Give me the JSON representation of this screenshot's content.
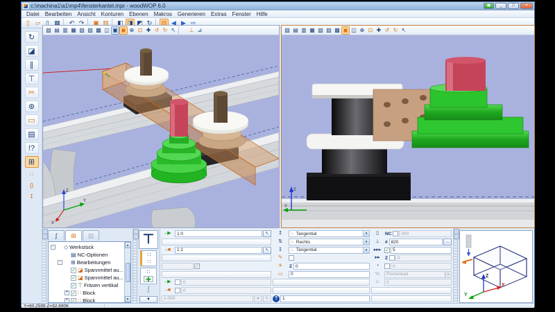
{
  "window": {
    "title": "c:\\machina1\\a1\\mp4\\fensterkantel.mpr - woodWOP 6.0",
    "buttons": {
      "lang": "▣",
      "minimize": "_",
      "maximize": "□",
      "close": "×"
    }
  },
  "menu_bar": {
    "items": [
      {
        "name": "menu-datei",
        "label": "Datei"
      },
      {
        "name": "menu-bearbeiten",
        "label": "Bearbeiten"
      },
      {
        "name": "menu-ansicht",
        "label": "Ansicht"
      },
      {
        "name": "menu-konturen",
        "label": "Konturen"
      },
      {
        "name": "menu-ebenen",
        "label": "Ebenen"
      },
      {
        "name": "menu-makros",
        "label": "Makros"
      },
      {
        "name": "menu-generieren",
        "label": "Generieren"
      },
      {
        "name": "menu-extras",
        "label": "Extras"
      },
      {
        "name": "menu-fenster",
        "label": "Fenster"
      },
      {
        "name": "menu-hilfe",
        "label": "Hilfe"
      }
    ]
  },
  "main_toolbar": {
    "items": [
      {
        "name": "new-file-button",
        "glyph": "▯",
        "cls": "c-orange"
      },
      {
        "name": "open-file-button",
        "glyph": "▱",
        "cls": "c-orange"
      },
      {
        "name": "new-from-template-button",
        "glyph": "▯"
      },
      {
        "name": "save-button",
        "glyph": "▦"
      },
      {
        "name": "separator",
        "glyph": "",
        "cls": "sep"
      },
      {
        "name": "undo-button",
        "glyph": "↶"
      },
      {
        "name": "redo-button",
        "glyph": "↷"
      },
      {
        "name": "separator",
        "glyph": "",
        "cls": "sep"
      },
      {
        "name": "copy-sheet-button",
        "glyph": "▣",
        "cls": "c-orange"
      },
      {
        "name": "paste-sheet-button",
        "glyph": "▥",
        "cls": "c-orange"
      },
      {
        "name": "separator",
        "glyph": "",
        "cls": "sep"
      },
      {
        "name": "view-wireframe-button",
        "glyph": "◧"
      },
      {
        "name": "view-shaded-button",
        "glyph": "◨",
        "cls": "sel"
      },
      {
        "name": "view-solid-button",
        "glyph": "◩"
      },
      {
        "name": "rotate-view-button",
        "glyph": "↻"
      },
      {
        "name": "separator",
        "glyph": "",
        "cls": "sep"
      },
      {
        "name": "nc-generate-button",
        "glyph": "▨",
        "cls": "sel c-orange"
      },
      {
        "name": "nav-back-button",
        "glyph": "◀",
        "cls": "c-blue"
      },
      {
        "name": "nav-play-button",
        "glyph": "▶",
        "cls": "c-blue"
      },
      {
        "name": "nav-forward-button",
        "glyph": "⇨",
        "cls": "c-blue"
      }
    ]
  },
  "left_toolbar": {
    "items": [
      {
        "name": "contour-rotate-button",
        "glyph": "↻"
      },
      {
        "name": "workplane-button",
        "glyph": "◪"
      },
      {
        "name": "drill-horizontal-button",
        "glyph": "∥"
      },
      {
        "name": "mill-vertical-button",
        "glyph": "⊤"
      },
      {
        "name": "saw-button",
        "glyph": "✂",
        "cls": "c-orange"
      },
      {
        "name": "circular-saw-button",
        "glyph": "⊛"
      },
      {
        "name": "pocket-button",
        "glyph": "▭",
        "cls": "c-orange"
      },
      {
        "name": "nc-document-button",
        "glyph": "▤"
      },
      {
        "name": "help-edit-button",
        "glyph": "!?"
      },
      {
        "name": "components-button",
        "glyph": "⊞",
        "cls": "sel"
      },
      {
        "name": "variables-button",
        "glyph": "∷",
        "cls": "small"
      },
      {
        "name": "braces-button",
        "glyph": "{}",
        "cls": "small"
      },
      {
        "name": "teach-button",
        "glyph": "↧",
        "cls": "small"
      }
    ]
  },
  "viewports": {
    "left": {
      "toolbar_items": [
        {
          "name": "view-iso-button",
          "glyph": "▧"
        },
        {
          "name": "view-front-button",
          "glyph": "▤"
        },
        {
          "name": "view-side-button",
          "glyph": "▥"
        },
        {
          "name": "view-top-button",
          "glyph": "▦"
        },
        {
          "name": "view-iso2-button",
          "glyph": "▧"
        },
        {
          "name": "view-iso3-button",
          "glyph": "▨"
        },
        {
          "name": "view-iso4-button",
          "glyph": "▩"
        },
        {
          "name": "view-custom-button",
          "glyph": "◫"
        },
        {
          "name": "shaded-view-button",
          "glyph": "▣",
          "cls": "sel-blue"
        },
        {
          "name": "textured-view-button",
          "glyph": "▣",
          "cls": "sel c-orange"
        },
        {
          "name": "zoom-in-button",
          "glyph": "⊕"
        },
        {
          "name": "zoom-window-button",
          "glyph": "⊡",
          "cls": "c-orange"
        },
        {
          "name": "pan-button",
          "glyph": "✚"
        },
        {
          "name": "rotate-free-button",
          "glyph": "↺",
          "cls": "c-orange"
        },
        {
          "name": "rotate-axis-button",
          "glyph": "↻",
          "cls": "c-orange"
        },
        {
          "name": "pointer-button",
          "glyph": "↖"
        },
        {
          "name": "separator",
          "glyph": "",
          "cls": "sep"
        },
        {
          "name": "measure-button",
          "glyph": "⊥",
          "cls": "c-orange"
        },
        {
          "name": "measure-angle-button",
          "glyph": "⊿"
        }
      ],
      "axis": {
        "x": "X",
        "y": "Y",
        "z": "Z"
      }
    },
    "right": {
      "toolbar_items": [
        {
          "name": "view-iso-button",
          "glyph": "▧"
        },
        {
          "name": "view-front-button",
          "glyph": "▤"
        },
        {
          "name": "view-side-button",
          "glyph": "▥"
        },
        {
          "name": "view-top-button",
          "glyph": "▦"
        },
        {
          "name": "view-iso2-button",
          "glyph": "▧"
        },
        {
          "name": "view-iso3-button",
          "glyph": "▨"
        },
        {
          "name": "view-iso4-button",
          "glyph": "▩"
        },
        {
          "name": "textured-view-button",
          "glyph": "▣",
          "cls": "sel c-orange"
        },
        {
          "name": "view-custom-button",
          "glyph": "◫"
        },
        {
          "name": "zoom-in-button",
          "glyph": "⊕"
        },
        {
          "name": "zoom-window-button",
          "glyph": "⊡",
          "cls": "c-orange"
        },
        {
          "name": "pan-button",
          "glyph": "✚"
        },
        {
          "name": "rotate-free-button",
          "glyph": "↺",
          "cls": "c-orange"
        },
        {
          "name": "rotate-axis-button",
          "glyph": "↻",
          "cls": "c-orange"
        },
        {
          "name": "pointer-button",
          "glyph": "↖"
        }
      ],
      "axis": {
        "y": "Y",
        "z": "Z"
      }
    }
  },
  "tree_panel": {
    "tabs": [
      {
        "name": "tab-contours",
        "glyph": "ʃ"
      },
      {
        "name": "tab-components",
        "glyph": "⊞",
        "cls": "active"
      },
      {
        "name": "tab-list",
        "glyph": "▤",
        "cls": "disabled"
      }
    ],
    "items": [
      {
        "name": "werkstueck",
        "expand": "-",
        "icon": "◇",
        "label": "Werkstück",
        "cls": "ind0 ic-navy"
      },
      {
        "name": "nc-optionen",
        "icon": "▤",
        "label": "NC-Optionen",
        "cls": "ind1 ic-navy"
      },
      {
        "name": "bearbeitungen",
        "expand": "-",
        "icon": "⊞",
        "label": "Bearbeitungen",
        "cls": "ind1 ic-navy"
      },
      {
        "name": "spannmittel-1",
        "check": "✓",
        "icon": "◪",
        "label": "Spannmittel au...",
        "cls": "ind2 ic-orange"
      },
      {
        "name": "spannmittel-2",
        "check": "✓",
        "icon": "◪",
        "label": "Spannmittel au...",
        "cls": "ind2 ic-orange"
      },
      {
        "name": "fraesen-vertikal",
        "check": "✓",
        "icon": "⊤",
        "label": "Fräsen vertikal",
        "cls": "ind2 ic-green"
      },
      {
        "name": "block-1",
        "expand": "+",
        "check": "✓",
        "icon": "∷",
        "label": "Block",
        "cls": "ind2 ic-orange"
      },
      {
        "name": "block-2",
        "expand": "+",
        "check": "✓",
        "icon": "∷",
        "label": "Block",
        "cls": "ind2 ic-orange"
      }
    ]
  },
  "icons": {
    "start": "–▶",
    "end": "–■",
    "picker": "↖",
    "approach": "↥",
    "correction": "⇅",
    "depart": "↧",
    "ramp": "✎",
    "gear": "✳",
    "pocket": "▭",
    "nc_doc": "▯",
    "toolchange": "⊥",
    "feed": "▸▸▸",
    "feed_z": "▸▸",
    "dwell": "◔",
    "spare": "⊔",
    "dd": "▾",
    "more": "…",
    "check": "✓",
    "plus": "✚",
    "scurve": "ʃ",
    "router": "⊤",
    "group": "∷",
    "up": "▲",
    "down": "▼"
  },
  "macro_panel": {
    "start_value": "1:0",
    "end_value": "1:1",
    "approach_value": "Tangential",
    "correction_value": "Rechts",
    "depart_value": "Tangential",
    "z_label": "Z",
    "z_value": "0",
    "pocket_value": "0",
    "aux_in_value": "0",
    "aux_out_value": "0",
    "length_value": "1.000",
    "nc_label": "NC",
    "nc_value": "000",
    "tool_hash": "#",
    "tool_value": "820",
    "feed_value": "5",
    "feed_z_label": "Z",
    "feed_z_value": "0",
    "dwell_value": "0",
    "percent_label": "%",
    "percent_value": "Prozentual",
    "spare_value": "0",
    "help_glyph": "?",
    "comment_value": "1"
  },
  "status_bar": {
    "coords": "Y=60.2599 Z=92.6906"
  }
}
